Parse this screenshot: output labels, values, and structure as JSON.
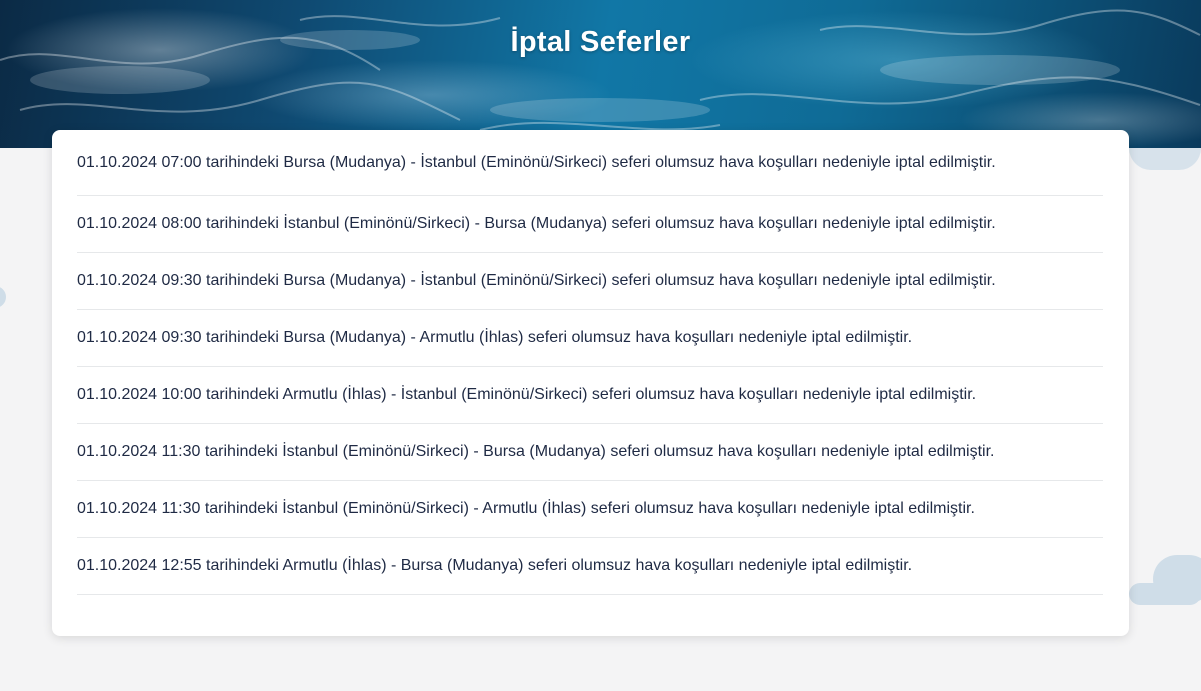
{
  "page": {
    "title": "İptal Seferler"
  },
  "cancellations": [
    {
      "text": "01.10.2024 07:00 tarihindeki Bursa (Mudanya) - İstanbul (Eminönü/Sirkeci) seferi olumsuz hava koşulları nedeniyle iptal edilmiştir."
    },
    {
      "text": "01.10.2024 08:00 tarihindeki İstanbul (Eminönü/Sirkeci) - Bursa (Mudanya) seferi olumsuz hava koşulları nedeniyle iptal edilmiştir."
    },
    {
      "text": "01.10.2024 09:30 tarihindeki Bursa (Mudanya) - İstanbul (Eminönü/Sirkeci) seferi olumsuz hava koşulları nedeniyle iptal edilmiştir."
    },
    {
      "text": "01.10.2024 09:30 tarihindeki Bursa (Mudanya) - Armutlu (İhlas) seferi olumsuz hava koşulları nedeniyle iptal edilmiştir."
    },
    {
      "text": "01.10.2024 10:00 tarihindeki Armutlu (İhlas) - İstanbul (Eminönü/Sirkeci) seferi olumsuz hava koşulları nedeniyle iptal edilmiştir."
    },
    {
      "text": "01.10.2024 11:30 tarihindeki İstanbul (Eminönü/Sirkeci) - Bursa (Mudanya) seferi olumsuz hava koşulları nedeniyle iptal edilmiştir."
    },
    {
      "text": "01.10.2024 11:30 tarihindeki İstanbul (Eminönü/Sirkeci) - Armutlu (İhlas) seferi olumsuz hava koşulları nedeniyle iptal edilmiştir."
    },
    {
      "text": "01.10.2024 12:55 tarihindeki Armutlu (İhlas) - Bursa (Mudanya) seferi olumsuz hava koşulları nedeniyle iptal edilmiştir."
    }
  ],
  "colors": {
    "text": "#1f2a44",
    "background": "#f4f4f5",
    "card": "#ffffff",
    "divider": "#e6e8ea",
    "cloud": "#cfdde8"
  }
}
